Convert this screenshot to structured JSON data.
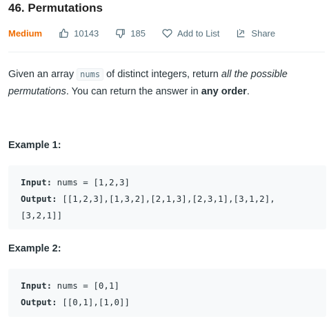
{
  "problem": {
    "title": "46. Permutations",
    "difficulty": "Medium",
    "likes": "10143",
    "dislikes": "185",
    "add_to_list_label": "Add to List",
    "share_label": "Share"
  },
  "description": {
    "part1": "Given an array ",
    "code": "nums",
    "part2": " of distinct integers, return ",
    "emphasis": "all the possible permutations",
    "part3": ". You can return the answer in ",
    "strong": "any order",
    "part4": "."
  },
  "examples": [
    {
      "heading": "Example 1:",
      "input_label": "Input:",
      "input_value": " nums = [1,2,3]",
      "output_label": "Output:",
      "output_value_line1": " [[1,2,3],[1,3,2],[2,1,3],[2,3,1],[3,1,2],",
      "output_value_line2": "[3,2,1]]"
    },
    {
      "heading": "Example 2:",
      "input_label": "Input:",
      "input_value": " nums = [0,1]",
      "output_label": "Output:",
      "output_value_line1": " [[0,1],[1,0]]"
    }
  ],
  "colors": {
    "difficulty_medium": "#ef6c00",
    "meta_text": "#546e7a",
    "code_background": "#f7f9fa"
  },
  "icons": [
    "thumbs-up-icon",
    "thumbs-down-icon",
    "heart-icon",
    "share-icon"
  ]
}
